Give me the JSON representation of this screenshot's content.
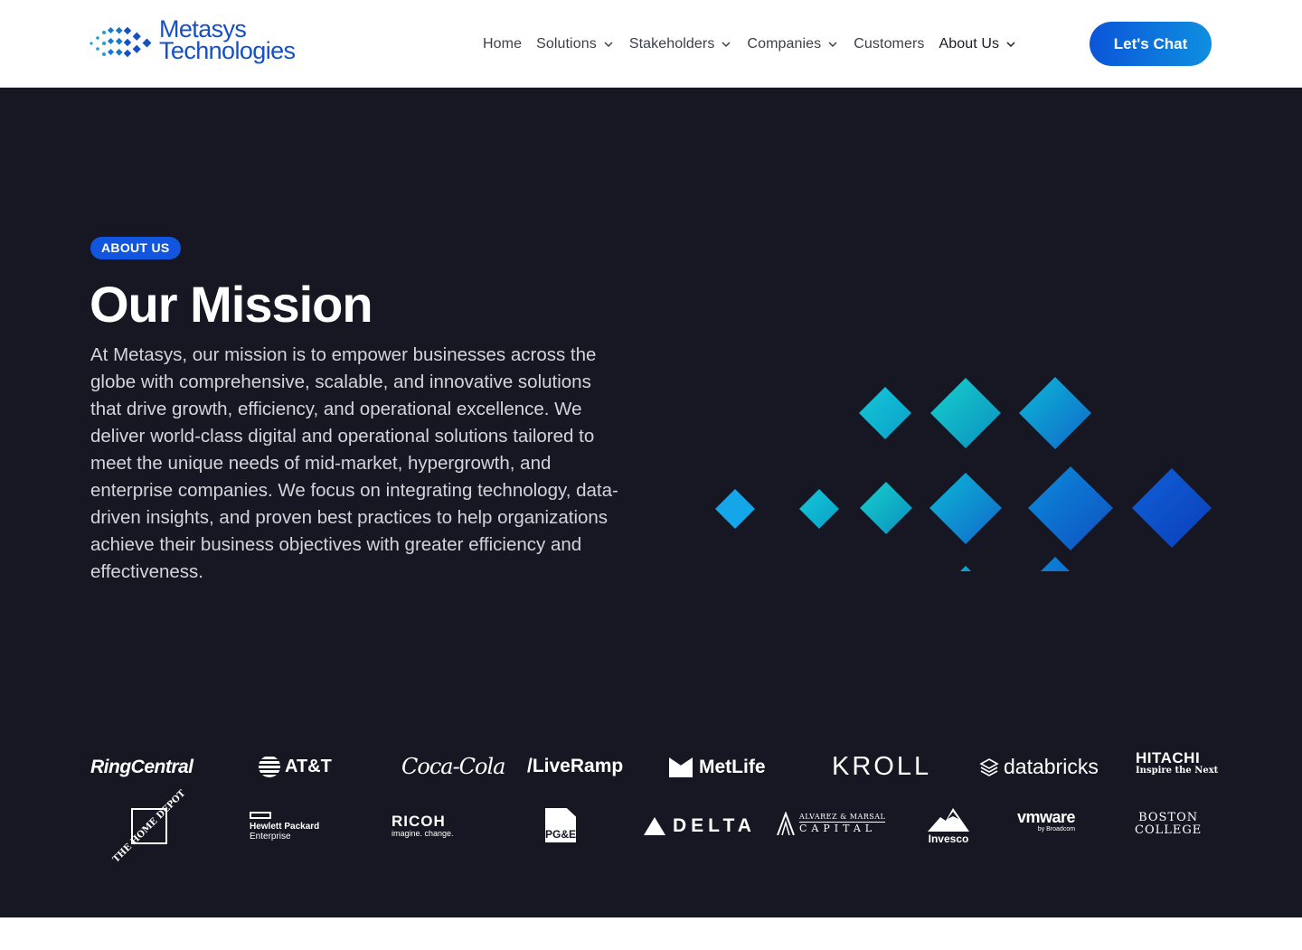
{
  "brand": {
    "name_line1": "Metasys",
    "name_line2": "Technologies",
    "primary_color": "#1650c6"
  },
  "nav": {
    "items": [
      {
        "label": "Home",
        "has_dropdown": false
      },
      {
        "label": "Solutions",
        "has_dropdown": true
      },
      {
        "label": "Stakeholders",
        "has_dropdown": true
      },
      {
        "label": "Companies",
        "has_dropdown": true
      },
      {
        "label": "Customers",
        "has_dropdown": false
      },
      {
        "label": "About Us",
        "has_dropdown": true
      }
    ],
    "cta_label": "Let's Chat"
  },
  "hero": {
    "badge": "ABOUT US",
    "title": "Our Mission",
    "body": "At Metasys, our mission is to empower businesses across the globe with comprehensive, scalable, and innovative solutions that drive growth, efficiency, and operational excellence. We deliver world-class digital and operational solutions tailored to meet the unique needs of mid-market, hypergrowth, and enterprise companies. We focus on integrating technology, data-driven insights, and proven best practices to help organizations achieve their business objectives with greater efficiency and effectiveness.",
    "background_color": "#161722",
    "accent_color": "#1256e0"
  },
  "customer_logos": {
    "row1": {
      "ringcentral": "RingCentral",
      "att": "AT&T",
      "cocacola": "Coca-Cola",
      "liveramp": "/LiveRamp",
      "metlife": "MetLife",
      "kroll": "KROLL",
      "databricks": "databricks",
      "hitachi": "HITACHI",
      "hitachi_tagline": "Inspire the Next"
    },
    "row2": {
      "homedepot": "THE HOME DEPOT",
      "hpe_line1": "Hewlett Packard",
      "hpe_line2": "Enterprise",
      "ricoh": "RICOH",
      "ricoh_tagline": "imagine. change.",
      "pge": "PG&E",
      "delta": "DELTA",
      "am_line1": "ALVAREZ & MARSAL",
      "am_line2": "CAPITAL",
      "invesco": "Invesco",
      "vmware": "vmware",
      "vmware_sub": "by Broadcom",
      "bc_line1": "BOSTON",
      "bc_line2": "COLLEGE"
    }
  }
}
